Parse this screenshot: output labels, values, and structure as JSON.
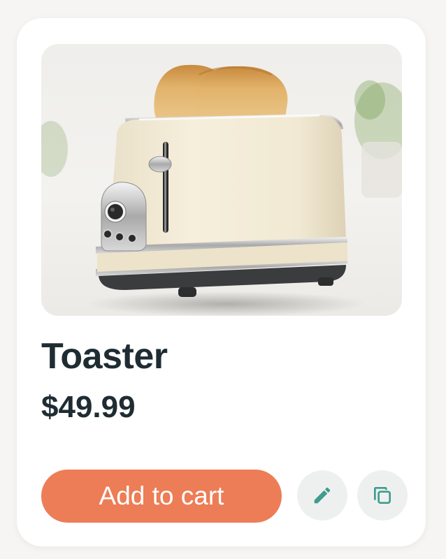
{
  "product": {
    "title": "Toaster",
    "price": "$49.99",
    "image_alt": "Cream retro two-slice toaster with toast"
  },
  "actions": {
    "add_to_cart_label": "Add to cart",
    "edit_icon": "pencil-icon",
    "copy_icon": "copy-icon"
  },
  "colors": {
    "accent": "#ec7d56",
    "icon_teal": "#3f9c8e",
    "text_dark": "#1f2d33",
    "icon_button_bg": "#eef0ef"
  }
}
